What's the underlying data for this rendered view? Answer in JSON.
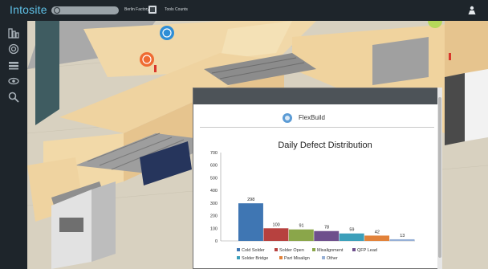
{
  "app": {
    "title": "Intosite",
    "crumbs": [
      "Berlin Factory",
      "Tools Counts"
    ]
  },
  "sidebar": {
    "icons": [
      "factory-icon",
      "target-icon",
      "layers-icon",
      "eye-icon",
      "search-icon"
    ]
  },
  "panel": {
    "brand": "FlexBuild"
  },
  "chart_data": {
    "type": "bar",
    "title": "Daily Defect Distribution",
    "categories": [
      "Cold Solder",
      "Solder Open",
      "Misalignment",
      "QFP Lead",
      "Solder Bridge",
      "Part Misalign",
      "Other"
    ],
    "values": [
      298,
      100,
      91,
      78,
      59,
      42,
      13
    ],
    "colors": [
      "#3f76b3",
      "#b7413f",
      "#8aa64a",
      "#6e4f8c",
      "#3c9fba",
      "#e2823a",
      "#96b0d6"
    ],
    "ylim": [
      0,
      700
    ],
    "yticks": [
      0,
      100,
      200,
      300,
      400,
      500,
      600,
      700
    ],
    "legend_position": "bottom",
    "grid": false
  }
}
